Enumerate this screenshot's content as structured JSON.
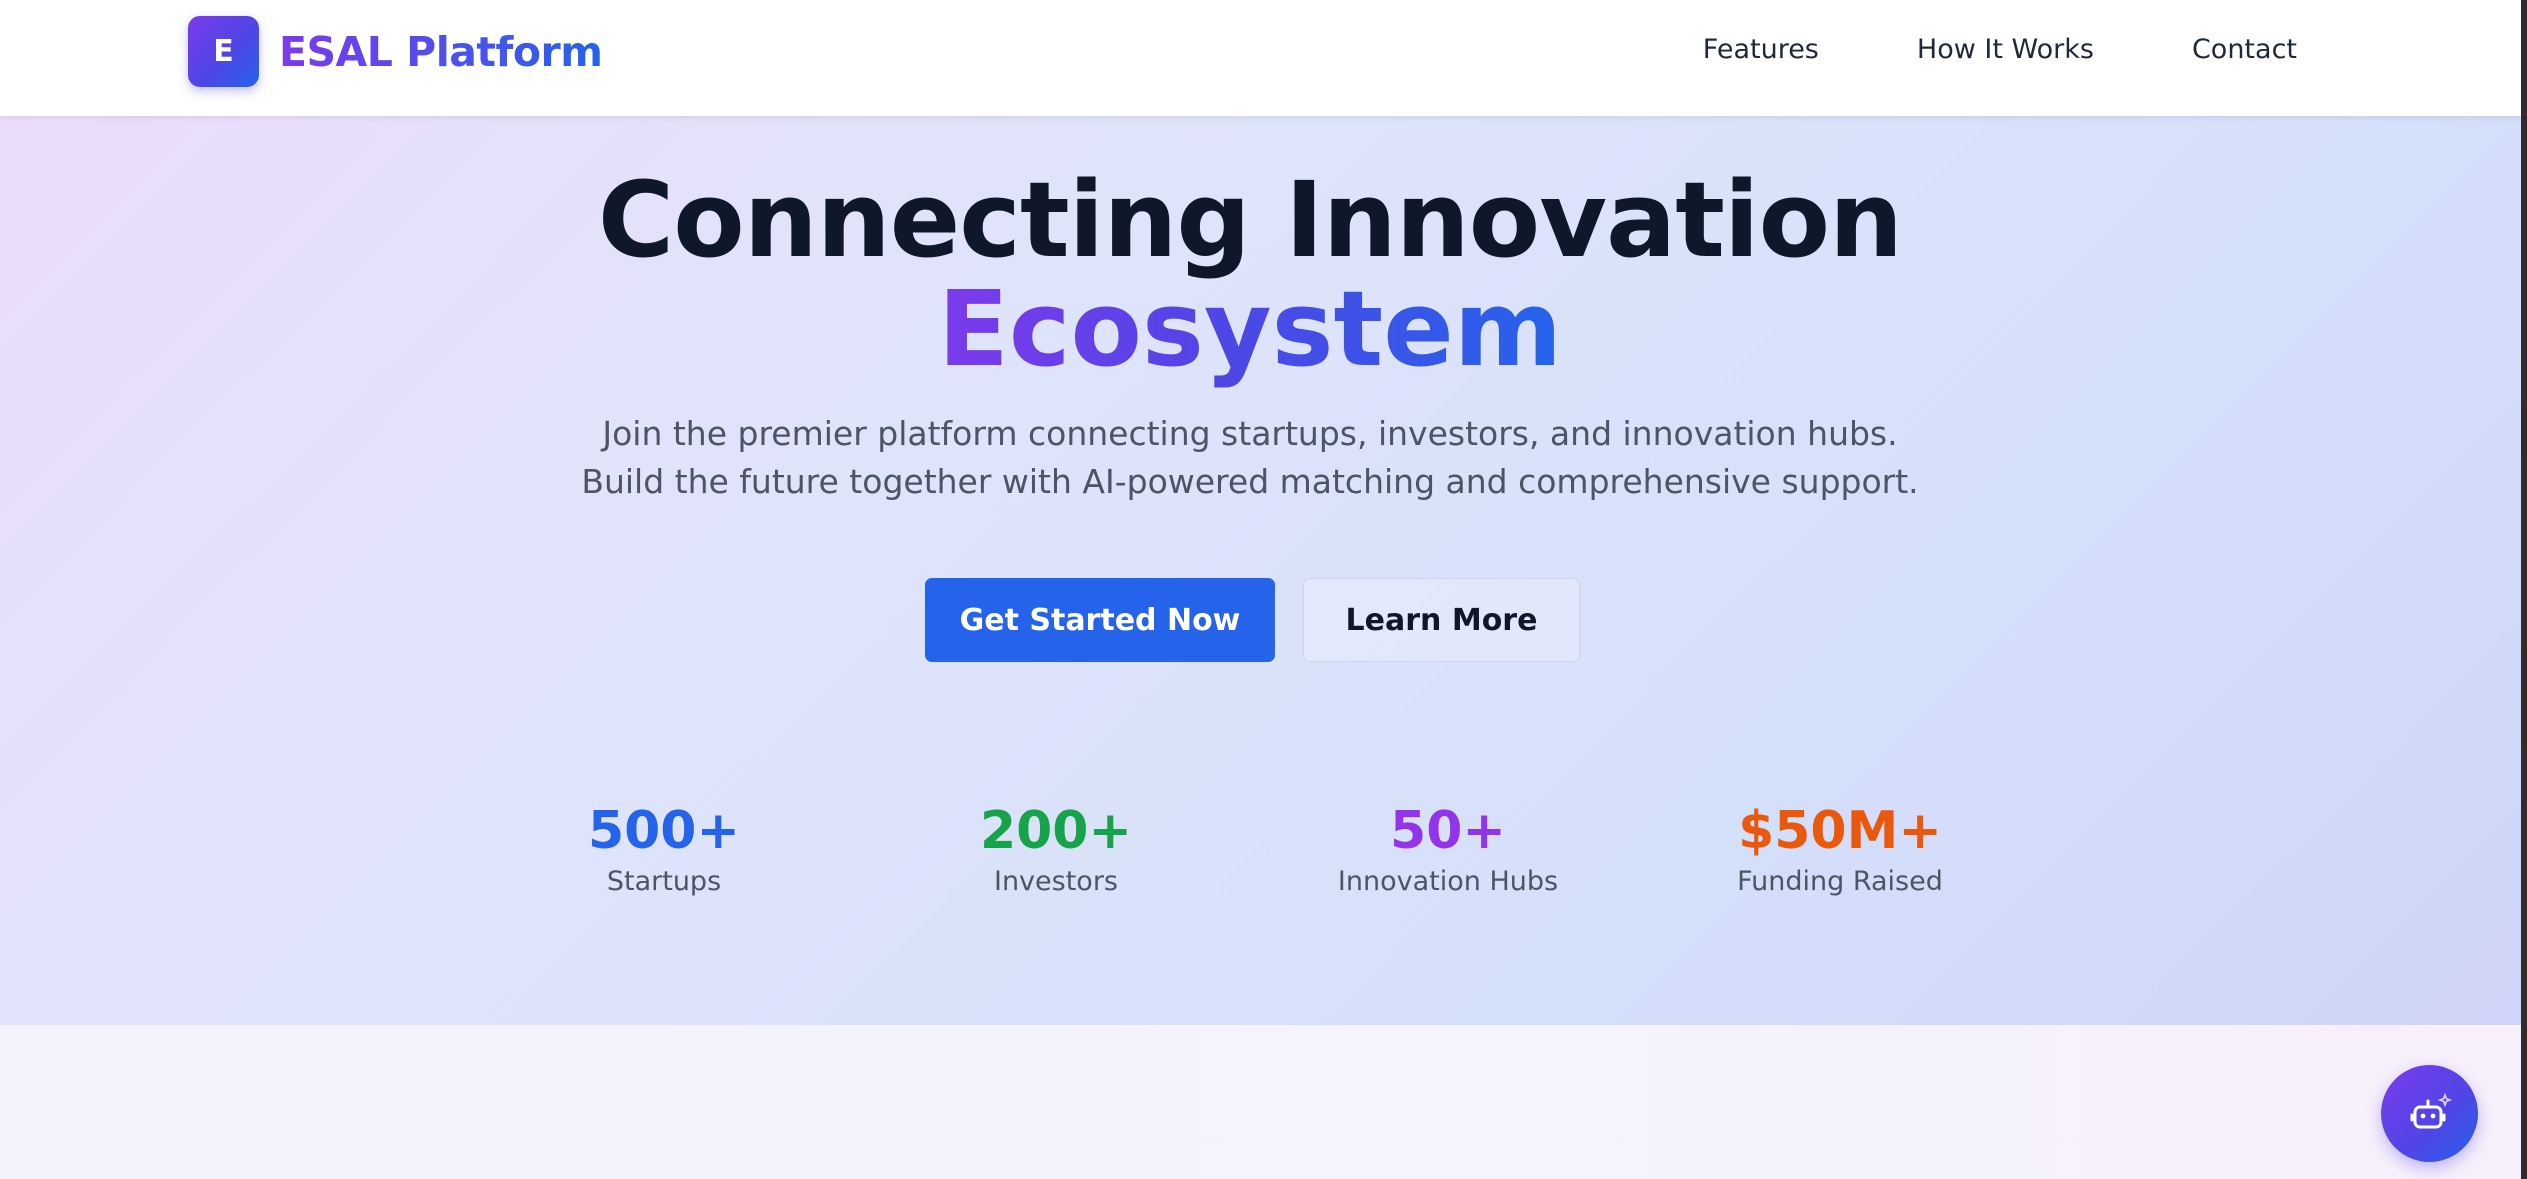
{
  "header": {
    "logo_letter": "E",
    "logo_text": "ESAL Platform",
    "nav": [
      "Features",
      "How It Works",
      "Contact"
    ]
  },
  "hero": {
    "title_line1": "Connecting Innovation",
    "title_line2": "Ecosystem",
    "subtitle_line1": "Join the premier platform connecting startups, investors, and innovation hubs.",
    "subtitle_line2": "Build the future together with AI-powered matching and comprehensive support.",
    "primary_cta": "Get Started Now",
    "secondary_cta": "Learn More"
  },
  "stats": [
    {
      "value": "500+",
      "label": "Startups",
      "color": "#2563eb"
    },
    {
      "value": "200+",
      "label": "Investors",
      "color": "#16a34a"
    },
    {
      "value": "50+",
      "label": "Innovation Hubs",
      "color": "#9333ea"
    },
    {
      "value": "$50M+",
      "label": "Funding Raised",
      "color": "#ea580c"
    }
  ],
  "chat": {
    "icon": "robot-icon"
  },
  "colors": {
    "brand_purple": "#7c3aed",
    "brand_blue": "#2563eb",
    "heading": "#0f172a"
  }
}
